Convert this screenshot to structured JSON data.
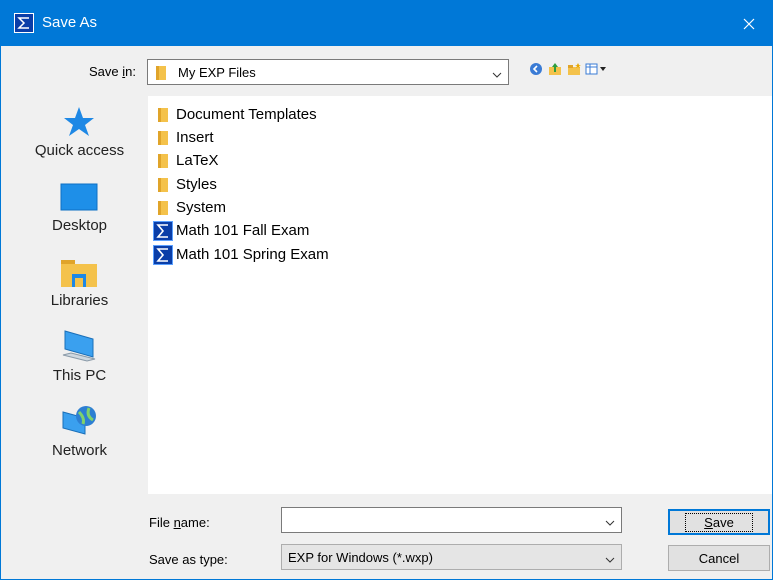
{
  "window": {
    "title": "Save As",
    "accent_color": "#0078d7"
  },
  "save_in": {
    "label_prefix": "Save ",
    "label_hotkey": "i",
    "label_suffix": "n:",
    "value": "My EXP Files"
  },
  "toolbar": {
    "icons": [
      "back-icon",
      "up-folder-icon",
      "new-folder-icon",
      "view-menu-icon"
    ]
  },
  "places": [
    {
      "label": "Quick access",
      "icon": "star-icon"
    },
    {
      "label": "Desktop",
      "icon": "desktop-icon"
    },
    {
      "label": "Libraries",
      "icon": "libraries-icon"
    },
    {
      "label": "This PC",
      "icon": "computer-icon"
    },
    {
      "label": "Network",
      "icon": "network-icon"
    }
  ],
  "files": [
    {
      "name": "Document Templates",
      "type": "folder"
    },
    {
      "name": "Insert",
      "type": "folder"
    },
    {
      "name": "LaTeX",
      "type": "folder"
    },
    {
      "name": "Styles",
      "type": "folder"
    },
    {
      "name": "System",
      "type": "folder"
    },
    {
      "name": "Math 101 Fall Exam",
      "type": "exp-document"
    },
    {
      "name": "Math 101 Spring Exam",
      "type": "exp-document"
    }
  ],
  "file_name": {
    "label_prefix": "File ",
    "label_hotkey": "n",
    "label_suffix": "ame:",
    "value": ""
  },
  "save_as_type": {
    "label": "Save as type:",
    "value": "EXP for Windows (*.wxp)"
  },
  "buttons": {
    "save_hotkey": "S",
    "save_rest": "ave",
    "cancel": "Cancel"
  }
}
